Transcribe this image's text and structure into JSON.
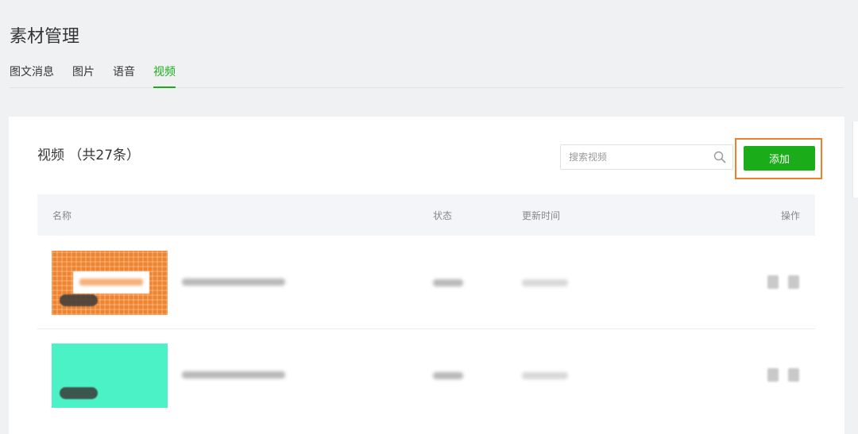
{
  "page": {
    "title": "素材管理"
  },
  "tabs": [
    {
      "label": "图文消息",
      "active": false
    },
    {
      "label": "图片",
      "active": false
    },
    {
      "label": "语音",
      "active": false
    },
    {
      "label": "视频",
      "active": true
    }
  ],
  "section": {
    "title": "视频 （共27条）"
  },
  "search": {
    "placeholder": "搜索视频",
    "value": ""
  },
  "toolbar": {
    "add_label": "添加"
  },
  "table": {
    "columns": {
      "name": "名称",
      "status": "状态",
      "updated": "更新时间",
      "actions": "操作"
    }
  },
  "colors": {
    "accent": "#1aad19",
    "highlight_border": "#f0802a",
    "thumb_1": "#f0842e",
    "thumb_2": "#4bf2c6"
  },
  "icons": [
    "search-icon",
    "copy-icon",
    "delete-icon",
    "play-icon"
  ]
}
